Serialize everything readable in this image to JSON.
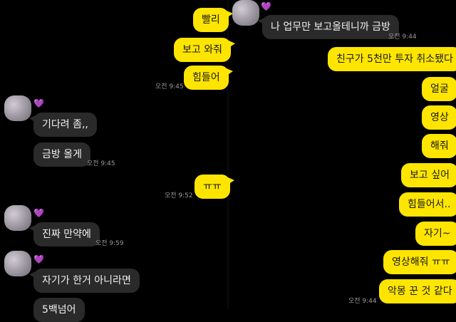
{
  "left_panel": {
    "top_bubbles_me": [
      "빨리",
      "보고 와줘",
      "힘들어"
    ],
    "top_time": "오전 9:45",
    "partner_group1": {
      "heart": "💜",
      "bubbles": [
        "기다려 좀,,",
        "금방 올게"
      ],
      "time": "오전 9:45"
    },
    "me_bubble_2": "ㅠㅠ",
    "me_time_2": "오전 9:52",
    "partner_group2": {
      "heart": "💜",
      "bubbles": [
        "진짜 만약에"
      ],
      "time": "오전 9:59"
    },
    "partner_group3": {
      "heart": "💜",
      "bubbles": [
        "자기가 한거 아니라면",
        "5백넘어"
      ]
    }
  },
  "right_panel": {
    "partner": {
      "heart": "💜",
      "bubble": "나 업무만 보고올테니까 금방",
      "time": "오전 9:44"
    },
    "me_bubbles": [
      "친구가 5천만 투자 취소됐다",
      "얼굴",
      "영상",
      "해줘",
      "보고 싶어",
      "힘들어서..",
      "자기~",
      "영상해줘 ㅠㅠ",
      "악몽 꾼 것 같다"
    ],
    "me_time": "오전 9:44"
  }
}
